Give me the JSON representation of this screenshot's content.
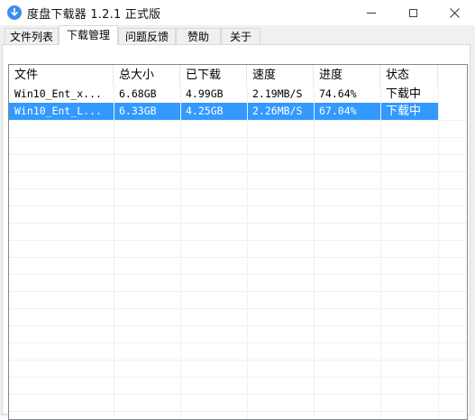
{
  "window": {
    "title": "度盘下载器 1.2.1 正式版",
    "icon": "download-arrow-icon",
    "controls": [
      "minimize-icon",
      "maximize-icon",
      "close-icon"
    ]
  },
  "tabs": [
    {
      "label": "文件列表",
      "active": false
    },
    {
      "label": "下载管理",
      "active": true
    },
    {
      "label": "问题反馈",
      "active": false
    },
    {
      "label": "赞助",
      "active": false
    },
    {
      "label": "关于",
      "active": false
    }
  ],
  "table": {
    "columns": [
      "文件",
      "总大小",
      "已下载",
      "速度",
      "进度",
      "状态"
    ],
    "rows": [
      {
        "file": "Win10_Ent_x...",
        "total": "6.68GB",
        "downloaded": "4.99GB",
        "speed": "2.19MB/S",
        "progress": "74.64%",
        "status": "下载中",
        "selected": false
      },
      {
        "file": "Win10_Ent_L...",
        "total": "6.33GB",
        "downloaded": "4.25GB",
        "speed": "2.26MB/S",
        "progress": "67.04%",
        "status": "下载中",
        "selected": true
      }
    ]
  },
  "colors": {
    "selection": "#3399ff",
    "icon": "#3b8ee8"
  }
}
